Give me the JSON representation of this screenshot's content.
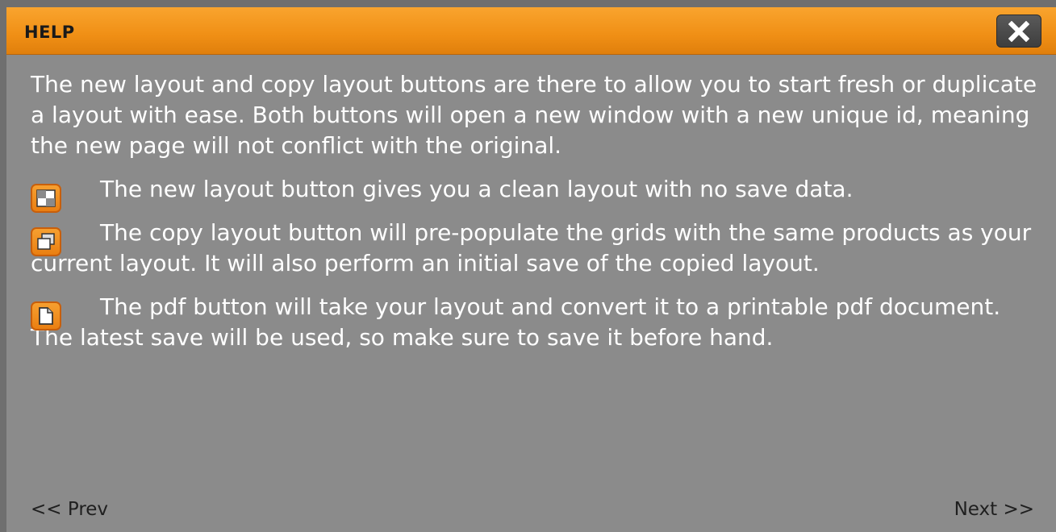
{
  "dialog": {
    "title": "HELP",
    "close_icon": "close-icon",
    "intro": "The new layout and copy layout buttons are there to allow you to start fresh or duplicate a layout with ease. Both buttons will open a new window with a new unique id, meaning the new page will not conflict with the original.",
    "items": [
      {
        "icon": "new-layout-icon",
        "text": "The new layout button gives you a clean layout with no save data."
      },
      {
        "icon": "copy-layout-icon",
        "text": "The copy layout button will pre-populate the grids with the same products as your current layout. It will also perform an initial save of the copied layout."
      },
      {
        "icon": "pdf-icon",
        "text": "The pdf button will take your layout and convert it to a printable pdf document. The latest save will be used, so make sure to save it before hand."
      }
    ],
    "nav": {
      "prev_label": "<< Prev",
      "next_label": "Next >>"
    }
  },
  "colors": {
    "titlebar": "#f08f15",
    "body_background": "#8b8b8b",
    "icon_orange": "#ea7f12",
    "close_button": "#4a4a4a"
  }
}
